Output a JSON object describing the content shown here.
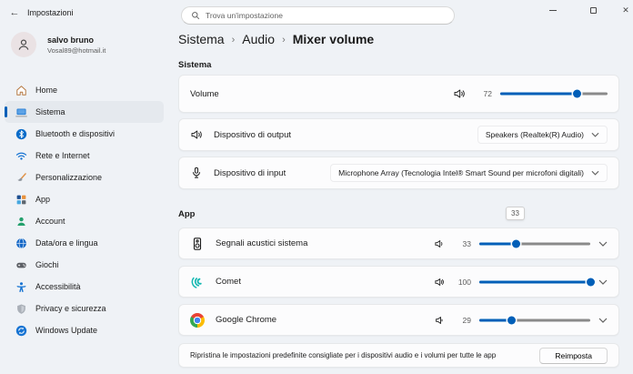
{
  "titlebar": {
    "back_glyph": "←",
    "app_title": "Impostazioni"
  },
  "user": {
    "name": "salvo bruno",
    "email": "Vosal89@hotmail.it"
  },
  "search": {
    "placeholder": "Trova un'impostazione"
  },
  "sidebar": {
    "items": [
      {
        "label": "Home",
        "icon": "home-icon",
        "selected": false
      },
      {
        "label": "Sistema",
        "icon": "system-icon",
        "selected": true
      },
      {
        "label": "Bluetooth e dispositivi",
        "icon": "bluetooth-icon",
        "selected": false
      },
      {
        "label": "Rete e Internet",
        "icon": "network-icon",
        "selected": false
      },
      {
        "label": "Personalizzazione",
        "icon": "personalization-icon",
        "selected": false
      },
      {
        "label": "App",
        "icon": "apps-icon",
        "selected": false
      },
      {
        "label": "Account",
        "icon": "account-icon",
        "selected": false
      },
      {
        "label": "Data/ora e lingua",
        "icon": "datetime-icon",
        "selected": false
      },
      {
        "label": "Giochi",
        "icon": "games-icon",
        "selected": false
      },
      {
        "label": "Accessibilità",
        "icon": "accessibility-icon",
        "selected": false
      },
      {
        "label": "Privacy e sicurezza",
        "icon": "privacy-icon",
        "selected": false
      },
      {
        "label": "Windows Update",
        "icon": "windows-update-icon",
        "selected": false
      }
    ]
  },
  "breadcrumb": {
    "part1": "Sistema",
    "part2": "Audio",
    "current": "Mixer volume",
    "separator": "›"
  },
  "system_section": {
    "label": "Sistema",
    "volume_row": {
      "label": "Volume",
      "value": 72,
      "icon": "speaker-waves-icon"
    },
    "output_row": {
      "label": "Dispositivo di output",
      "icon": "speaker-waves-icon",
      "selected_option": "Speakers (Realtek(R) Audio)"
    },
    "input_row": {
      "label": "Dispositivo di input",
      "icon": "microphone-icon",
      "selected_option": "Microphone Array (Tecnologia Intel® Smart Sound per microfoni digitali)"
    }
  },
  "app_section": {
    "label": "App",
    "slider_tooltip": "33",
    "rows": [
      {
        "name": "Segnali acustici sistema",
        "volume": 33,
        "icon": "system-sounds-icon"
      },
      {
        "name": "Comet",
        "volume": 100,
        "icon": "comet-app-icon"
      },
      {
        "name": "Google Chrome",
        "volume": 29,
        "icon": "chrome-app-icon"
      }
    ]
  },
  "reset_section": {
    "description": "Ripristina le impostazioni predefinite consigliate per i dispositivi audio e i volumi per tutte le app",
    "button_label": "Reimposta"
  },
  "colors": {
    "accent": "#005FB8",
    "background": "#EFF2F6",
    "card": "#FCFCFD",
    "card_border": "#E6E8EA",
    "track_inactive": "#8A8A8A",
    "text_secondary": "#5D5D5D"
  },
  "icons": {
    "back": "arrow-left",
    "search": "magnifier",
    "minimize": "dash",
    "maximize": "square",
    "close": "x",
    "chevron": "chevron-down",
    "volume_small_33": "speaker-one-wave",
    "volume_small_100": "speaker-two-waves",
    "volume_small_29": "speaker-plain"
  }
}
